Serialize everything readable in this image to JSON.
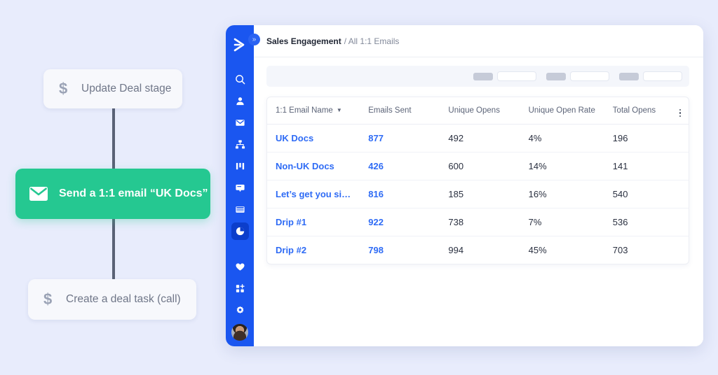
{
  "flow": {
    "nodes": [
      {
        "id": "update-deal-stage",
        "icon": "dollar-icon",
        "label": "Update Deal stage",
        "type": "plain"
      },
      {
        "id": "send-email",
        "icon": "mail-icon",
        "label": "Send a 1:1 email “UK Docs”",
        "type": "active"
      },
      {
        "id": "create-deal-task",
        "icon": "dollar-icon",
        "label": "Create a deal task (call)",
        "type": "plain"
      }
    ],
    "dollar_glyph": "$",
    "accent_color": "#25c891"
  },
  "app": {
    "sidebar": {
      "logo_name": "app-logo",
      "expand_label": "»",
      "items": [
        {
          "name": "search",
          "icon": "search-icon",
          "active": false
        },
        {
          "name": "contacts",
          "icon": "person-icon",
          "active": false
        },
        {
          "name": "email",
          "icon": "envelope-icon",
          "active": false
        },
        {
          "name": "workflows",
          "icon": "org-chart-icon",
          "active": false
        },
        {
          "name": "pipeline",
          "icon": "columns-icon",
          "active": false
        },
        {
          "name": "conversations",
          "icon": "chat-icon",
          "active": false
        },
        {
          "name": "lists",
          "icon": "table-icon",
          "active": false
        },
        {
          "name": "reports",
          "icon": "pie-chart-icon",
          "active": true
        }
      ],
      "bottom_items": [
        {
          "name": "favorites",
          "icon": "heart-icon"
        },
        {
          "name": "apps",
          "icon": "app-grid-add-icon"
        },
        {
          "name": "settings",
          "icon": "gear-icon"
        }
      ],
      "avatar_name": "user-avatar",
      "bg_color": "#1a56f0",
      "active_color": "#0c3ecb"
    },
    "breadcrumb": {
      "section": "Sales Engagement",
      "current": "/ All 1:1 Emails"
    },
    "filters": [
      {
        "name": "filter-1"
      },
      {
        "name": "filter-2"
      },
      {
        "name": "filter-3"
      }
    ],
    "table": {
      "columns": [
        "1:1  Email Name",
        "Emails Sent",
        "Unique Opens",
        "Unique Open Rate",
        "Total Opens"
      ],
      "sort_column": 0,
      "sort_caret": "▼",
      "menu_name": "table-options-menu",
      "rows": [
        {
          "name": "UK Docs",
          "emails_sent": "877",
          "unique_opens": "492",
          "unique_open_rate": "4%",
          "total_opens": "196"
        },
        {
          "name": "Non-UK Docs",
          "emails_sent": "426",
          "unique_opens": "600",
          "unique_open_rate": "14%",
          "total_opens": "141"
        },
        {
          "name": "Let’s get you si…",
          "emails_sent": "816",
          "unique_opens": "185",
          "unique_open_rate": "16%",
          "total_opens": "540"
        },
        {
          "name": "Drip #1",
          "emails_sent": "922",
          "unique_opens": "738",
          "unique_open_rate": "7%",
          "total_opens": "536"
        },
        {
          "name": "Drip #2",
          "emails_sent": "798",
          "unique_opens": "994",
          "unique_open_rate": "45%",
          "total_opens": "703"
        }
      ],
      "link_color": "#2e6bf5"
    }
  }
}
